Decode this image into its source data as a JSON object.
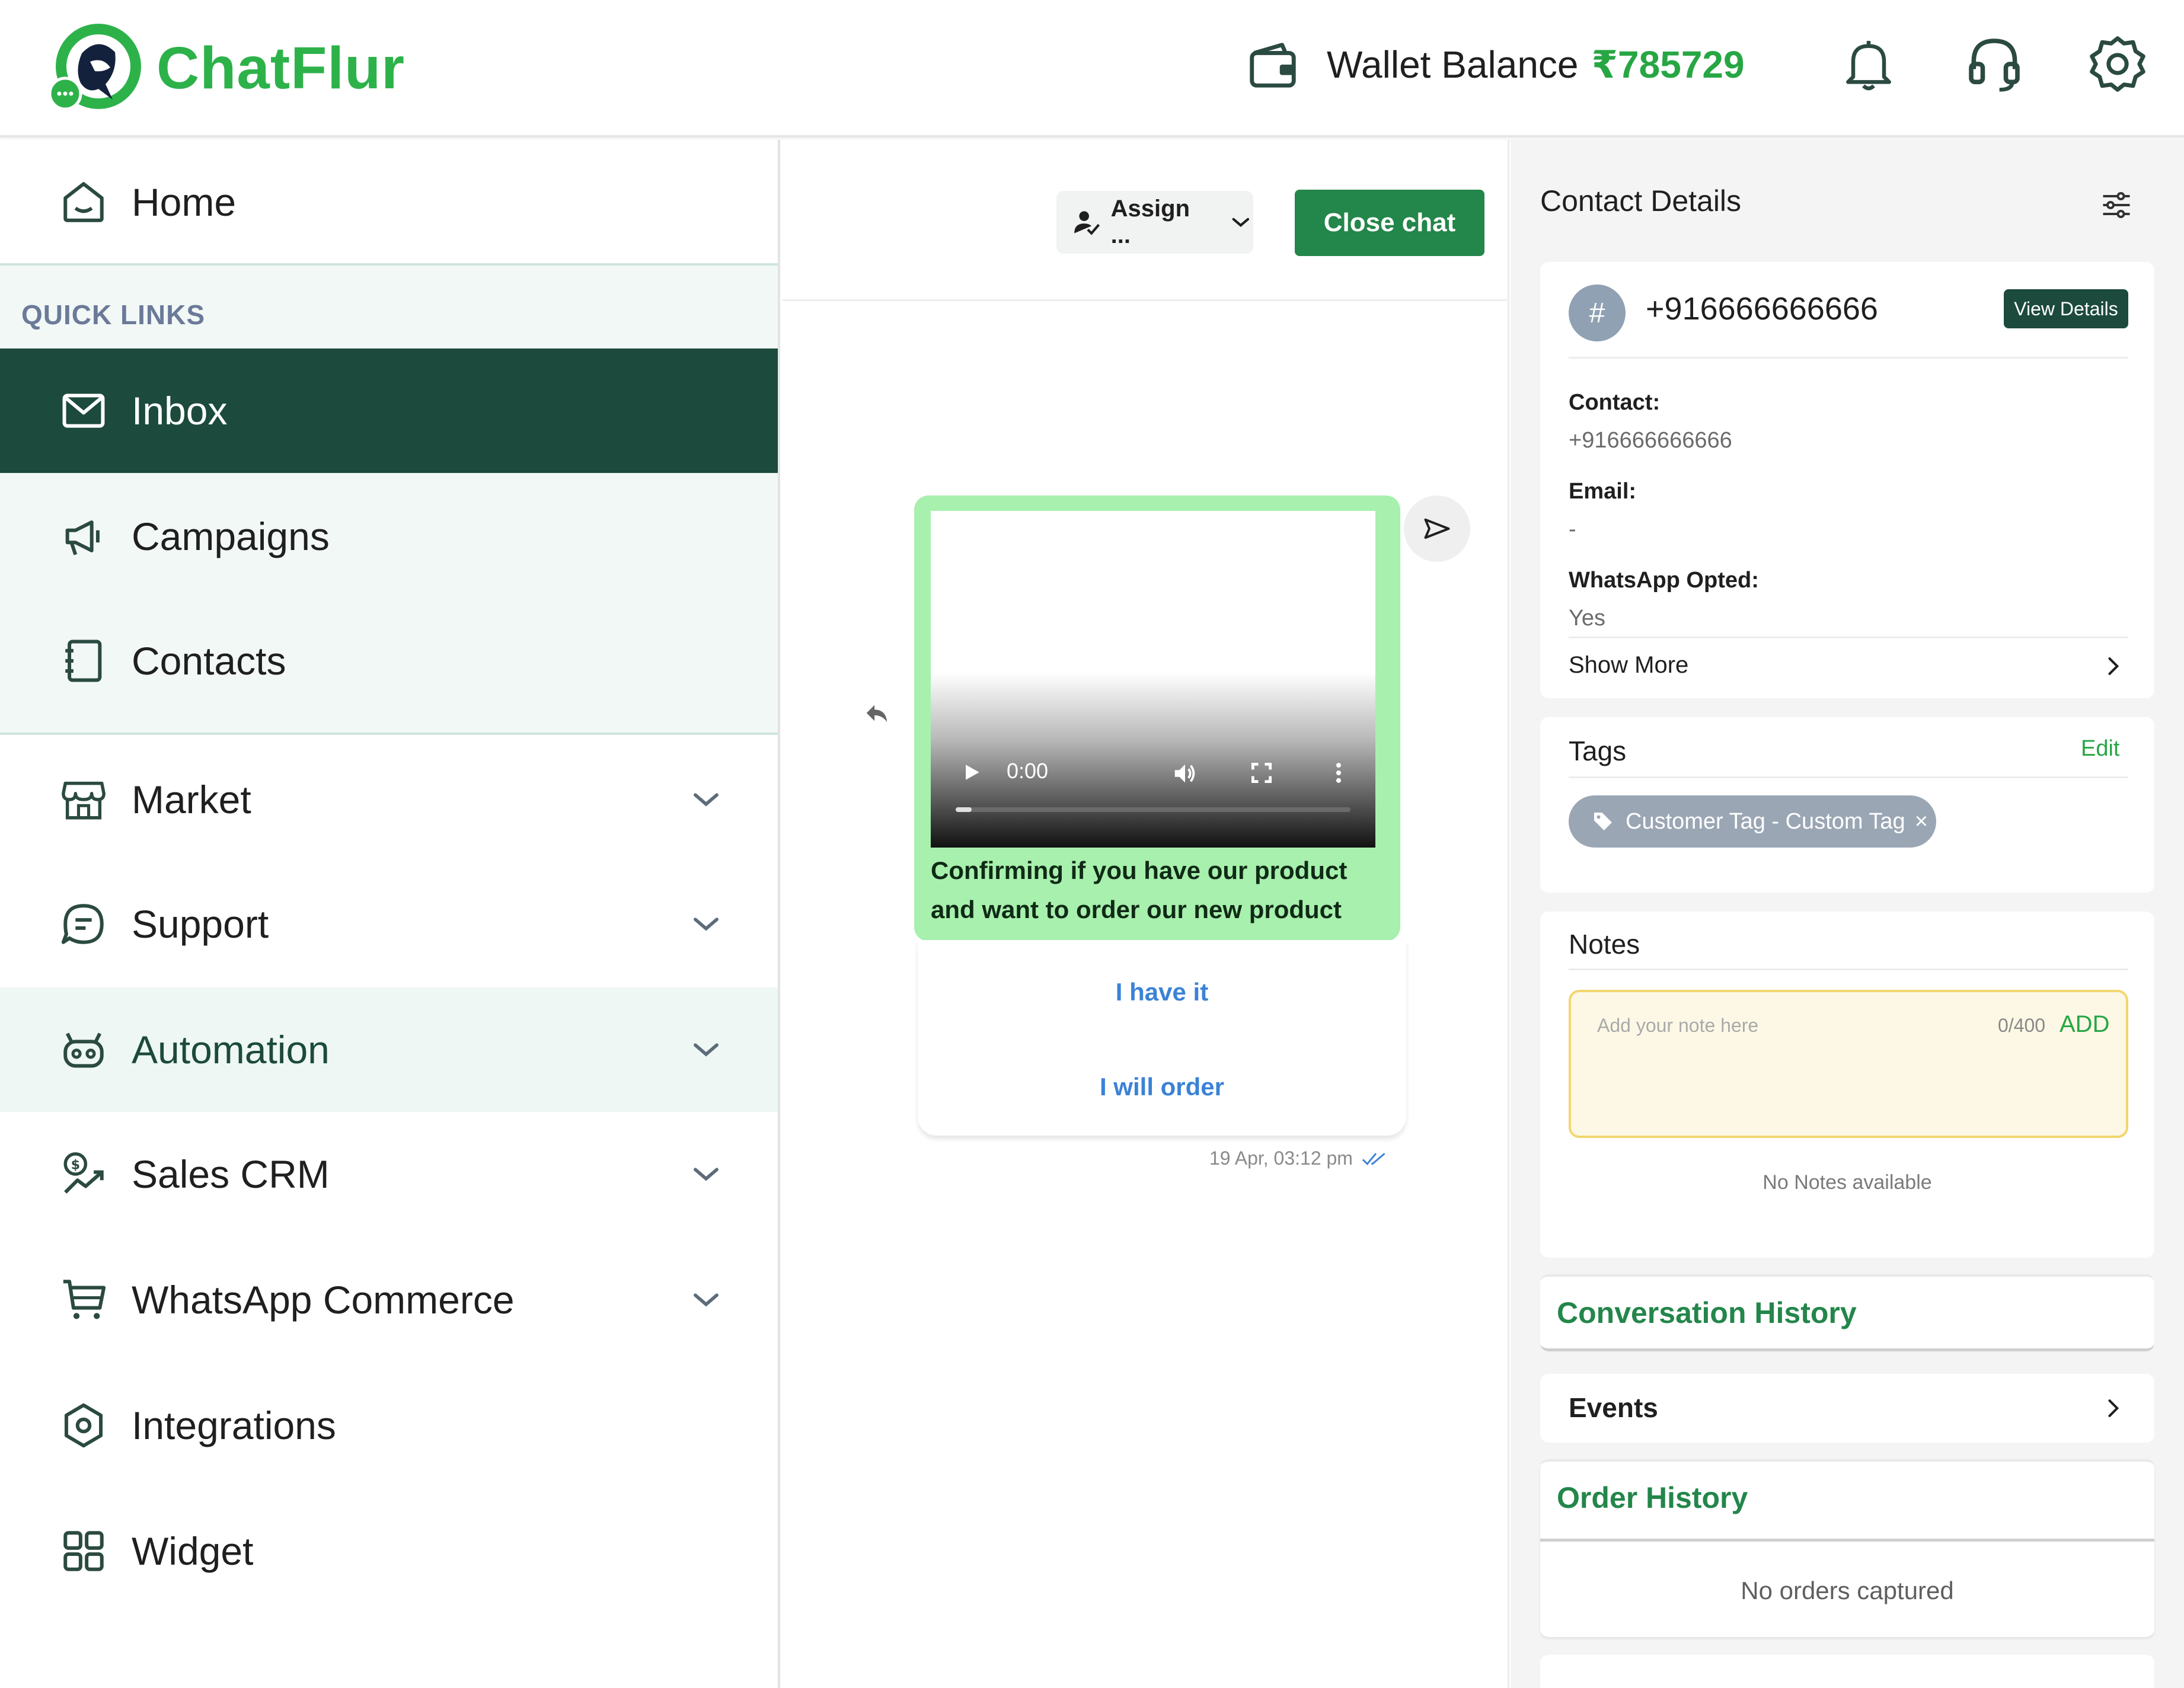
{
  "header": {
    "brand": "ChatFlur",
    "wallet_label": "Wallet Balance",
    "wallet_amount": "₹785729",
    "icons": [
      "wallet-icon",
      "bell-icon",
      "headset-icon",
      "gear-icon"
    ]
  },
  "sidebar": {
    "home": "Home",
    "quick_links": "QUICK LINKS",
    "items": [
      {
        "label": "Inbox",
        "icon": "mail-icon",
        "active": true
      },
      {
        "label": "Campaigns",
        "icon": "megaphone-icon"
      },
      {
        "label": "Contacts",
        "icon": "address-book-icon"
      },
      {
        "label": "Market",
        "icon": "store-icon",
        "expandable": true
      },
      {
        "label": "Support",
        "icon": "chat-bubble-icon",
        "expandable": true
      },
      {
        "label": "Automation",
        "icon": "robot-icon",
        "expandable": true,
        "highlighted": true
      },
      {
        "label": "Sales CRM",
        "icon": "sales-chart-icon",
        "expandable": true
      },
      {
        "label": "WhatsApp Commerce",
        "icon": "cart-icon",
        "expandable": true
      },
      {
        "label": "Integrations",
        "icon": "hexagon-icon"
      },
      {
        "label": "Widget",
        "icon": "grid-icon"
      }
    ]
  },
  "chat": {
    "assign_label": "Assign ...",
    "close_label": "Close chat",
    "video_time": "0:00",
    "video_progress": 0.04,
    "caption": "Confirming if you have our product and want to order our new product",
    "quick_replies": [
      "I have it",
      "I will order"
    ],
    "timestamp": "19 Apr, 03:12 pm"
  },
  "contact": {
    "title": "Contact Details",
    "avatar_symbol": "#",
    "phone": "+916666666666",
    "view_details": "View Details",
    "contact_label": "Contact:",
    "contact_value": "+916666666666",
    "email_label": "Email:",
    "email_value": "-",
    "whatsapp_label": "WhatsApp Opted:",
    "whatsapp_value": "Yes",
    "show_more": "Show More",
    "tags_title": "Tags",
    "tags_edit": "Edit",
    "tag": "Customer Tag - Custom Tag",
    "tag_remove": "×",
    "notes_title": "Notes",
    "notes_placeholder": "Add your note here",
    "notes_count": "0/400",
    "notes_add": "ADD",
    "notes_empty": "No Notes available",
    "conversation_history": "Conversation History",
    "events": "Events",
    "order_history": "Order History",
    "no_orders": "No orders captured"
  },
  "colors": {
    "brand_green": "#2db24a",
    "sidebar_active": "#1c4a3c",
    "button_green": "#23864a",
    "bubble_green": "#a8f0ad",
    "link_blue": "#3b82d6"
  }
}
